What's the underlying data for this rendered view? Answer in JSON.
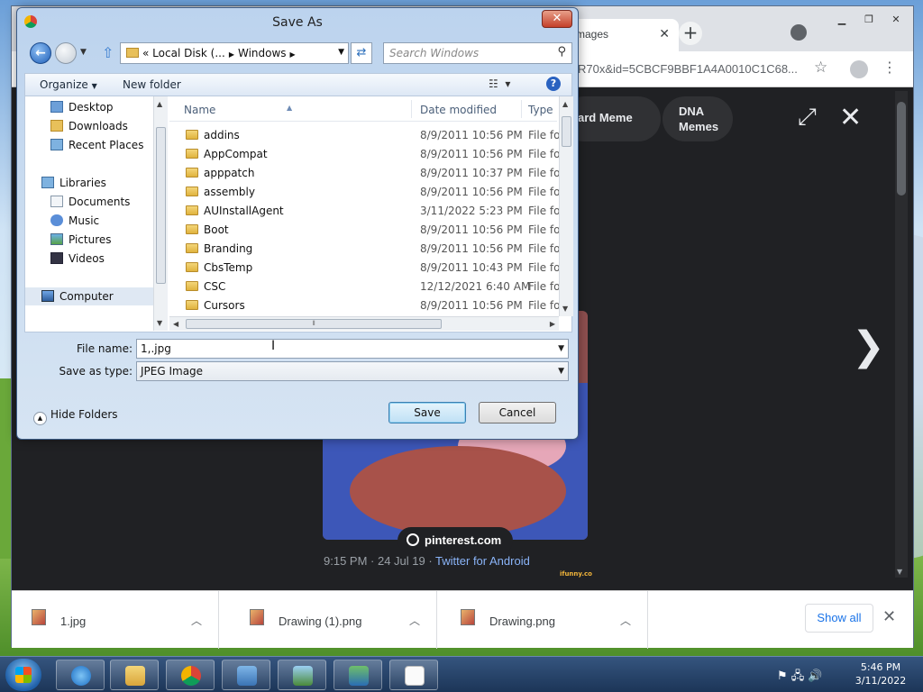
{
  "browser": {
    "tab_title": "mages",
    "url": "R70x&id=5CBCF9BBF1A4A0010C1C68...",
    "chips": [
      "ard Meme",
      "DNA Memes"
    ],
    "source_badge": "pinterest.com",
    "caption_time": "9:15 PM · 24 Jul 19 · ",
    "caption_link": "Twitter for Android",
    "watermark": "ifunny.co"
  },
  "downloads": {
    "items": [
      {
        "name": "1.jpg"
      },
      {
        "name": "Drawing (1).png"
      },
      {
        "name": "Drawing.png"
      }
    ],
    "show_all": "Show all"
  },
  "dialog": {
    "title": "Save As",
    "path": {
      "prefix": "«",
      "parts": [
        "Local Disk (...",
        "Windows"
      ]
    },
    "search_placeholder": "Search Windows",
    "toolbar": {
      "organize": "Organize",
      "new_folder": "New folder"
    },
    "nav": [
      {
        "label": "Desktop",
        "icon": "desktop-icon"
      },
      {
        "label": "Downloads",
        "icon": "downloads-icon"
      },
      {
        "label": "Recent Places",
        "icon": "recent-places-icon"
      },
      {
        "label": "Libraries",
        "icon": "libraries-icon"
      },
      {
        "label": "Documents",
        "icon": "documents-icon"
      },
      {
        "label": "Music",
        "icon": "music-icon"
      },
      {
        "label": "Pictures",
        "icon": "pictures-icon"
      },
      {
        "label": "Videos",
        "icon": "videos-icon"
      },
      {
        "label": "Computer",
        "icon": "computer-icon"
      }
    ],
    "columns": {
      "name": "Name",
      "date": "Date modified",
      "type": "Type"
    },
    "files": [
      {
        "name": "addins",
        "date": "8/9/2011 10:56 PM",
        "type": "File fol"
      },
      {
        "name": "AppCompat",
        "date": "8/9/2011 10:56 PM",
        "type": "File fol"
      },
      {
        "name": "apppatch",
        "date": "8/9/2011 10:37 PM",
        "type": "File fol"
      },
      {
        "name": "assembly",
        "date": "8/9/2011 10:56 PM",
        "type": "File fol"
      },
      {
        "name": "AUInstallAgent",
        "date": "3/11/2022 5:23 PM",
        "type": "File fol"
      },
      {
        "name": "Boot",
        "date": "8/9/2011 10:56 PM",
        "type": "File fol"
      },
      {
        "name": "Branding",
        "date": "8/9/2011 10:56 PM",
        "type": "File fol"
      },
      {
        "name": "CbsTemp",
        "date": "8/9/2011 10:43 PM",
        "type": "File fol"
      },
      {
        "name": "CSC",
        "date": "12/12/2021 6:40 AM",
        "type": "File fol"
      },
      {
        "name": "Cursors",
        "date": "8/9/2011 10:56 PM",
        "type": "File fol"
      }
    ],
    "file_name_label": "File name:",
    "file_name_value": "1,.jpg",
    "save_type_label": "Save as type:",
    "save_type_value": "JPEG Image",
    "hide_folders": "Hide Folders",
    "save": "Save",
    "cancel": "Cancel"
  },
  "clock": {
    "time": "5:46 PM",
    "date": "3/11/2022"
  }
}
